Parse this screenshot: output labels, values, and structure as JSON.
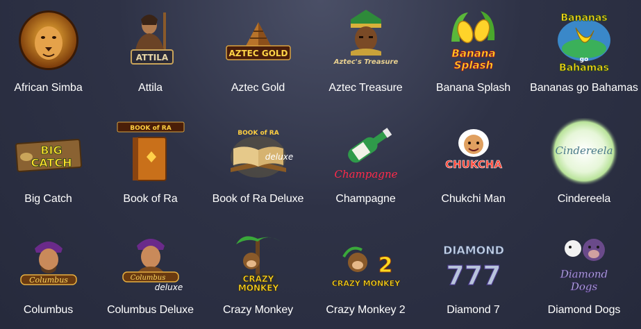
{
  "games": [
    {
      "name": "African Simba",
      "icon": "lion-icon"
    },
    {
      "name": "Attila",
      "icon": "warrior-icon",
      "logo": "ATTILA"
    },
    {
      "name": "Aztec Gold",
      "icon": "pyramid-icon",
      "logo": "AZTEC GOLD"
    },
    {
      "name": "Aztec Treasure",
      "icon": "aztec-head-icon",
      "logo": "Aztec's Treasure"
    },
    {
      "name": "Banana Splash",
      "icon": "banana-splash-icon",
      "logo": "Banana Splash"
    },
    {
      "name": "Bananas go Bahamas",
      "icon": "banana-icon",
      "logo": "Bananas go Bahamas"
    },
    {
      "name": "Big Catch",
      "icon": "fish-sign-icon",
      "logo": "BIG CATCH"
    },
    {
      "name": "Book of Ra",
      "icon": "book-icon",
      "logo": "BOOK of RA"
    },
    {
      "name": "Book of Ra Deluxe",
      "icon": "open-book-icon",
      "logo": "BOOK of RA",
      "badge": "deluxe"
    },
    {
      "name": "Champagne",
      "icon": "champagne-bottle-icon",
      "logo": "Champagne"
    },
    {
      "name": "Chukchi Man",
      "icon": "chukchi-icon",
      "logo": "CHUKCHA"
    },
    {
      "name": "Cindereela",
      "icon": "glow-orb-icon",
      "logo": "Cindereela"
    },
    {
      "name": "Columbus",
      "icon": "columbus-icon",
      "logo": "Columbus"
    },
    {
      "name": "Columbus Deluxe",
      "icon": "columbus-deluxe-icon",
      "logo": "Columbus",
      "badge": "deluxe"
    },
    {
      "name": "Crazy Monkey",
      "icon": "monkey-palm-icon",
      "logo": "CRAZY MONKEY"
    },
    {
      "name": "Crazy Monkey 2",
      "icon": "monkey-two-icon",
      "logo": "CRAZY MONKEY",
      "badge": "2"
    },
    {
      "name": "Diamond 7",
      "icon": "diamond-seven-icon",
      "logo": "DIAMOND",
      "badge": "777"
    },
    {
      "name": "Diamond Dogs",
      "icon": "dog-icon",
      "logo": "Diamond Dogs"
    }
  ]
}
